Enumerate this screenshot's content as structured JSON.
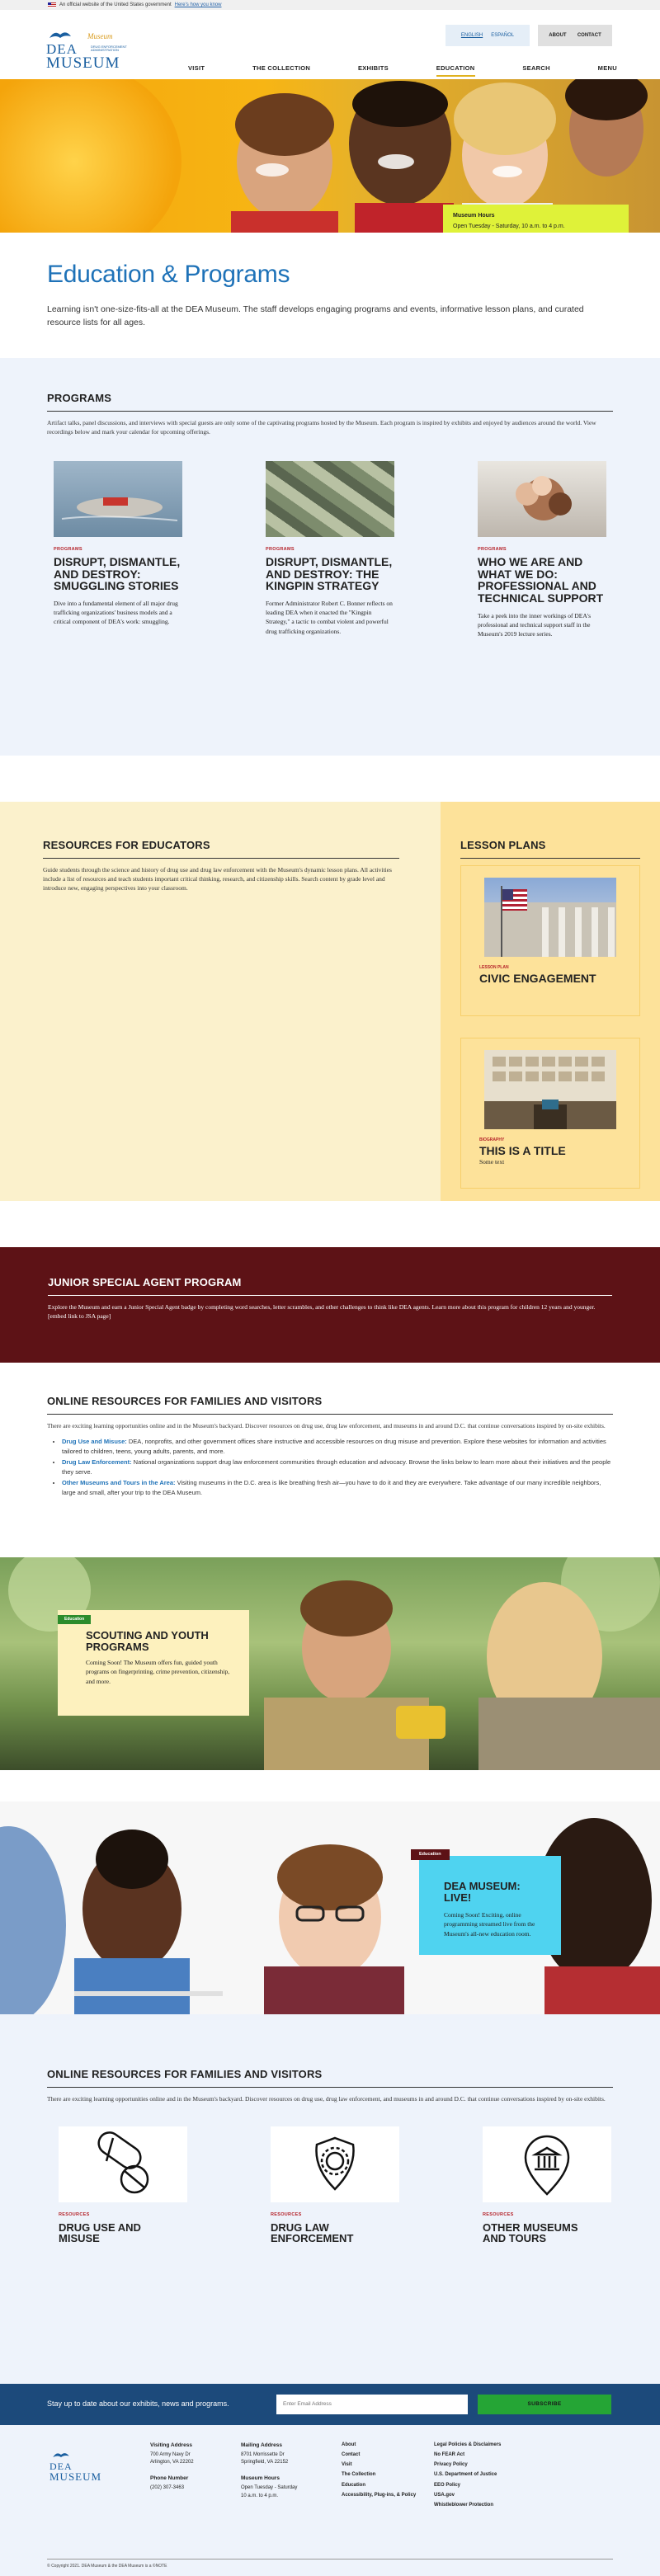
{
  "gov_banner": {
    "text": "An official website of the United States government",
    "link": "Here's how you know"
  },
  "logo": {
    "script": "Museum",
    "line1": "DEA",
    "line2": "MUSEUM",
    "tag": "DRUG ENFORCEMENT ADMINISTRATION"
  },
  "lang": {
    "english": "ENGLISH",
    "spanish": "ESPAÑOL"
  },
  "top_buttons": {
    "about": "ABOUT",
    "contact": "CONTACT"
  },
  "nav": {
    "items": [
      "VISIT",
      "THE COLLECTION",
      "EXHIBITS",
      "EDUCATION",
      "SEARCH",
      "MENU"
    ]
  },
  "hero": {
    "hours_title": "Museum Hours",
    "hours_text": "Open Tuesday - Saturday, 10 a.m. to 4 p.m."
  },
  "intro": {
    "title": "Education & Programs",
    "text": "Learning isn't one-size-fits-all at the DEA Museum. The staff develops engaging programs and events, informative lesson plans, and curated resource lists for all ages."
  },
  "programs": {
    "title": "PROGRAMS",
    "lead": "Artifact talks, panel discussions, and interviews with special guests are only some of the captivating programs hosted by the Museum. Each program is inspired by exhibits and enjoyed by audiences around the world. View recordings below and mark your calendar for upcoming offerings.",
    "cards": [
      {
        "cat": "PROGRAMS",
        "title": "DISRUPT, DISMANTLE, AND DESTROY: SMUGGLING STORIES",
        "text": "Dive into a fundamental element of all major drug trafficking organizations' business models and a critical component of DEA's work: smuggling."
      },
      {
        "cat": "PROGRAMS",
        "title": "DISRUPT, DISMANTLE, AND DESTROY: THE KINGPIN STRATEGY",
        "text": "Former Administrator Robert C. Bonner reflects on leading DEA when it enacted the \"Kingpin Strategy,\" a tactic to combat violent and powerful drug trafficking organizations."
      },
      {
        "cat": "PROGRAMS",
        "title": "WHO WE ARE AND WHAT WE DO: PROFESSIONAL AND TECHNICAL SUPPORT",
        "text": "Take a peek into the inner workings of DEA's professional and technical support staff in the Museum's 2019 lecture series."
      }
    ]
  },
  "educators": {
    "title": "RESOURCES FOR EDUCATORS",
    "text": "Guide students through the science and history of drug use and drug law enforcement with the Museum's dynamic lesson plans. All activities include a list of resources and teach students important critical thinking, research, and citizenship skills. Search content by grade level and introduce new, engaging perspectives into your classroom.",
    "lesson_title": "LESSON PLANS",
    "lessons": [
      {
        "cat": "LESSON PLAN",
        "title": "CIVIC ENGAGEMENT",
        "text": ""
      },
      {
        "cat": "BIOGRAPHY",
        "title": "THIS IS A TITLE",
        "text": "Some text"
      }
    ]
  },
  "junior": {
    "title": "JUNIOR SPECIAL AGENT PROGRAM",
    "text": "Explore the Museum and earn a Junior Special Agent badge by completing word searches, letter scrambles, and other challenges to think like DEA agents. Learn more about this program for children 12 years and younger. [embed link to JSA page]"
  },
  "online": {
    "title": "ONLINE RESOURCES FOR FAMILIES AND VISITORS",
    "lead": "There are exciting learning opportunities online and in the Museum's backyard. Discover resources on drug use, drug law enforcement, and museums in and around D.C. that continue conversations inspired by on-site exhibits.",
    "items": [
      {
        "head": "Drug Use and Misuse:",
        "text": " DEA, nonprofits, and other government offices share instructive and accessible resources on drug misuse and prevention. Explore these websites for information and activities tailored to children, teens, young adults, parents, and more."
      },
      {
        "head": "Drug Law Enforcement:",
        "text": " National organizations support drug law enforcement communities through education and advocacy. Browse the links below to learn more about their initiatives and the people they serve."
      },
      {
        "head": "Other Museums and Tours in the Area:",
        "text": " Visiting museums in the D.C. area is like breathing fresh air—you have to do it and they are everywhere. Take advantage of our many incredible neighbors, large and small, after your trip to the DEA Museum."
      }
    ]
  },
  "scout": {
    "tag": "Education",
    "title": "SCOUTING AND YOUTH PROGRAMS",
    "text": "Coming Soon! The Museum offers fun, guided youth programs on fingerprinting, crime prevention, citizenship, and more."
  },
  "live": {
    "tag": "Education",
    "title": "DEA MUSEUM: LIVE!",
    "text": "Coming Soon! Exciting, online programming streamed live from the Museum's all-new education room."
  },
  "online2": {
    "title": "ONLINE RESOURCES FOR FAMILIES AND VISITORS",
    "lead": "There are exciting learning opportunities online and in the Museum's backyard. Discover resources on drug use, drug law enforcement, and museums in and around D.C. that continue conversations inspired by on-site exhibits.",
    "cards": [
      {
        "cat": "RESOURCES",
        "title": "DRUG USE AND MISUSE",
        "icon": "pills-icon"
      },
      {
        "cat": "RESOURCES",
        "title": "DRUG LAW ENFORCEMENT",
        "icon": "badge-icon"
      },
      {
        "cat": "RESOURCES",
        "title": "OTHER MUSEUMS AND TOURS",
        "icon": "museum-pin-icon"
      }
    ]
  },
  "newsletter": {
    "text": "Stay up to date about our exhibits, news and programs.",
    "placeholder": "Enter Email Address",
    "button": "SUBSCRIBE"
  },
  "footer": {
    "visiting_title": "Visiting Address",
    "visiting_l1": "700 Army Navy Dr",
    "visiting_l2": "Arlington, VA 22202",
    "phone_title": "Phone Number",
    "phone": "(202) 307-3463",
    "mailing_title": "Mailing Address",
    "mailing_l1": "8701 Morrissette Dr",
    "mailing_l2": "Springfield, VA 22152",
    "hours_title": "Museum Hours",
    "hours_l1": "Open Tuesday - Saturday",
    "hours_l2": "10 a.m. to 4 p.m.",
    "links1": [
      "About",
      "Contact",
      "Visit",
      "The Collection",
      "Education",
      "Accessibility, Plug-ins, & Policy"
    ],
    "links2": [
      "Legal Policies & Disclaimers",
      "No FEAR Act",
      "Privacy Policy",
      "U.S. Department of Justice",
      "EEO Policy",
      "USA.gov",
      "Whistleblower Protection"
    ],
    "copyright": "© Copyright 2021. DEA Museum & the DEA Museum is a ©NOTE"
  },
  "colors": {
    "brand_blue": "#1e72b8",
    "accent_yellow": "#dff239",
    "maroon": "#5d1216",
    "green": "#25a535",
    "red_label": "#b5232a"
  }
}
